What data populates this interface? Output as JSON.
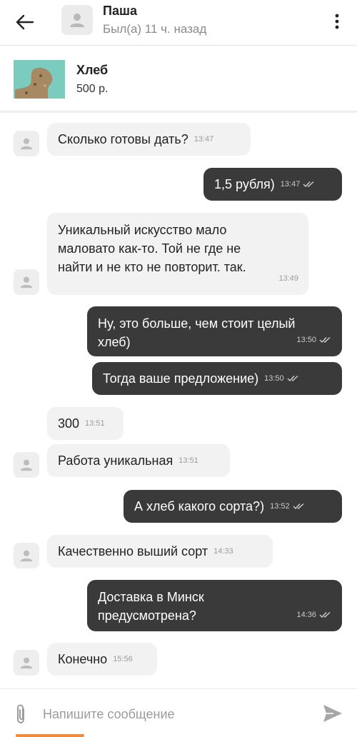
{
  "header": {
    "name": "Паша",
    "status": "Был(а) 11 ч. назад"
  },
  "product": {
    "title": "Хлеб",
    "price": "500 р."
  },
  "messages": [
    {
      "dir": "in",
      "text": "Сколько готовы дать?",
      "time": "13:47"
    },
    {
      "dir": "out",
      "text": "1,5 рубля)",
      "time": "13:47",
      "status": "read"
    },
    {
      "dir": "in",
      "text": "Уникальный искусство мало маловато как-то. Той не где не найти и не кто не повторит.  так.",
      "time": "13:49"
    },
    {
      "dir": "out",
      "text": "Ну, это больше, чем стоит целый хлеб)",
      "time": "13:50",
      "status": "read"
    },
    {
      "dir": "out",
      "text": "Тогда ваше предложение)",
      "time": "13:50",
      "status": "read"
    },
    {
      "dir": "in",
      "text": "300",
      "time": "13:51"
    },
    {
      "dir": "in",
      "text": "Работа уникальная",
      "time": "13:51"
    },
    {
      "dir": "out",
      "text": "А хлеб какого сорта?)",
      "time": "13:52",
      "status": "read"
    },
    {
      "dir": "in",
      "text": "Качественно выший сорт",
      "time": "14:33"
    },
    {
      "dir": "out",
      "text": "Доставка в Минск предусмотрена?",
      "time": "14:36",
      "status": "read"
    },
    {
      "dir": "in",
      "text": "Конечно",
      "time": "15:56"
    }
  ],
  "composer": {
    "placeholder": "Напишите сообщение",
    "value": ""
  },
  "icons": {
    "back": "arrow-left-icon",
    "menu": "more-vertical-icon",
    "avatar": "user-placeholder-icon",
    "attach": "paperclip-icon",
    "send": "send-icon",
    "read": "double-check-icon"
  },
  "colors": {
    "outgoing_bubble": "#3a3a3a",
    "incoming_bubble": "#f2f2f2",
    "accent": "#f08a3c"
  }
}
